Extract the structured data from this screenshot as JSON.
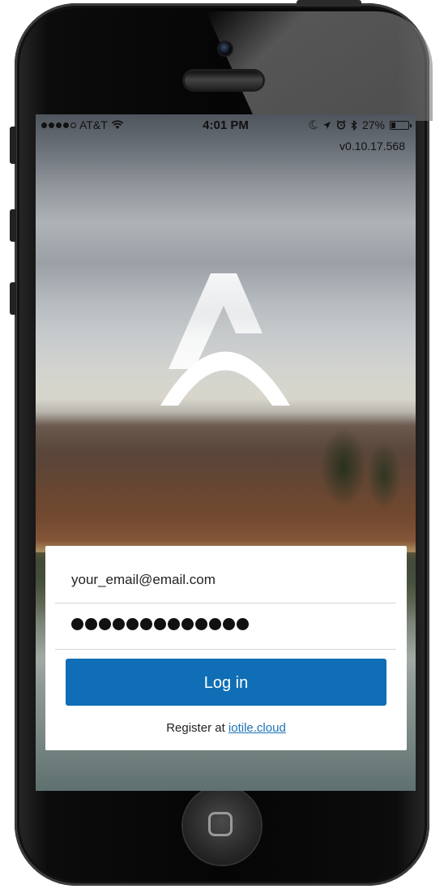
{
  "status_bar": {
    "carrier": "AT&T",
    "time": "4:01 PM",
    "battery_percent": "27%",
    "battery_level": 0.27,
    "signal_bars_filled": 4,
    "signal_bars_total": 5,
    "icons": [
      "wifi-icon",
      "moon-icon",
      "location-arrow-icon",
      "alarm-icon",
      "bluetooth-icon",
      "battery-icon"
    ]
  },
  "app": {
    "version": "v0.10.17.568",
    "logo": "arch-a-logo"
  },
  "login": {
    "email_value": "your_email@email.com",
    "password_mask_count": 13,
    "login_label": "Log in",
    "register_prefix": "Register at ",
    "register_link": "iotile.cloud"
  },
  "colors": {
    "accent": "#0f6eb5",
    "link": "#1a73b8"
  }
}
